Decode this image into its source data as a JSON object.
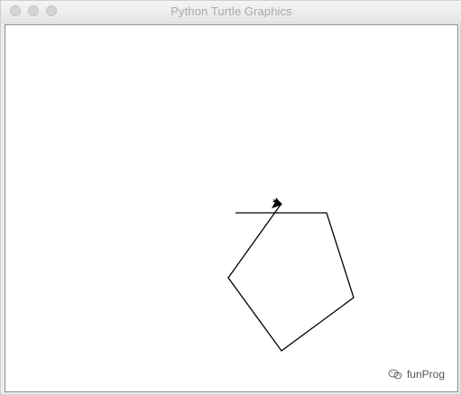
{
  "window": {
    "title": "Python Turtle Graphics"
  },
  "canvas": {
    "background": "#ffffff",
    "pen_color": "#000000",
    "turtle_shape": "classic-arrow",
    "turtle_color": "#000000"
  },
  "watermark": {
    "text": "funProg",
    "icon": "wechat-logo"
  }
}
